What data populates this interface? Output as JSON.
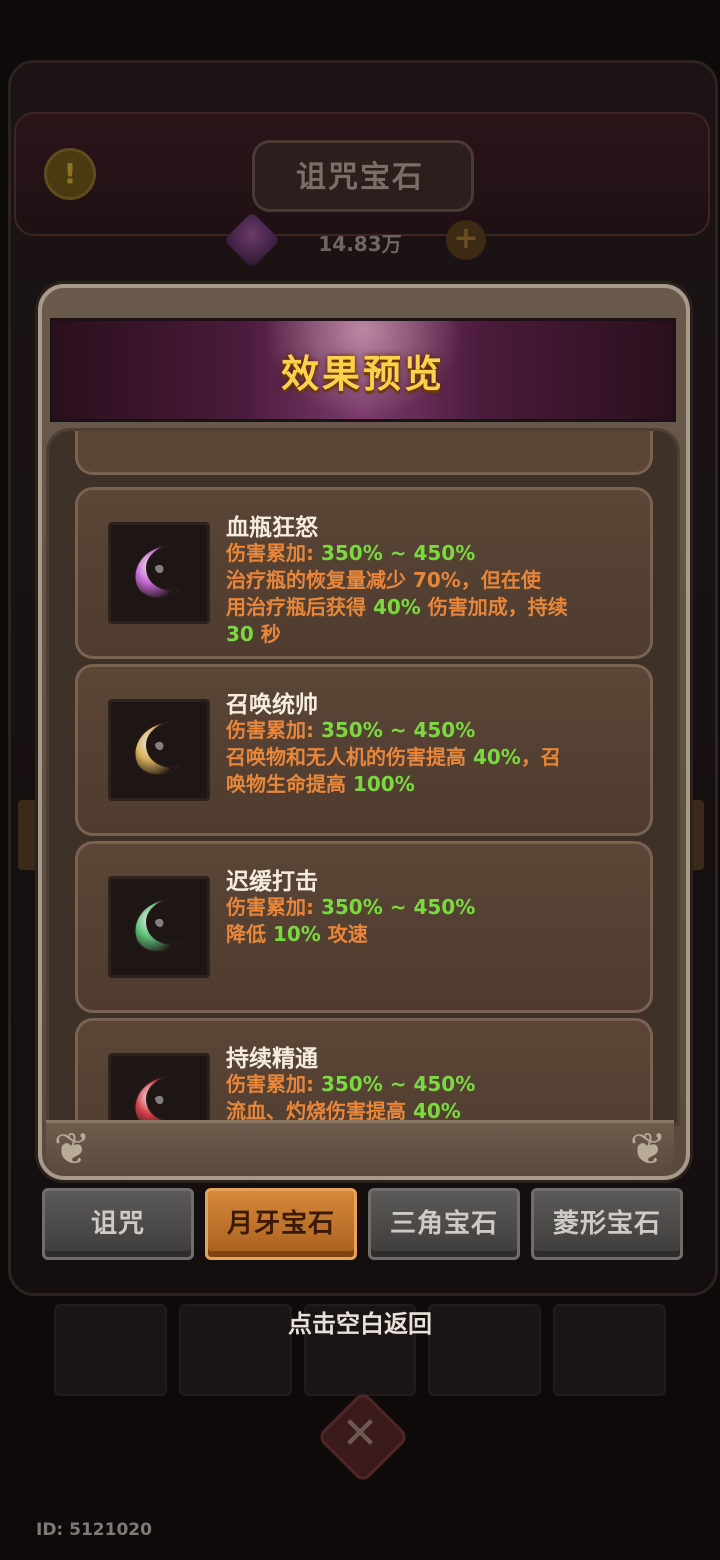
{
  "background": {
    "title": "诅咒宝石",
    "currency_amount": "14.83万",
    "warn_icon": "!",
    "plus_icon": "+"
  },
  "modal": {
    "title": "效果预览",
    "items": [
      {
        "name": "血瓶狂怒",
        "gem_color": "#c66ad6",
        "lines": [
          [
            {
              "t": "伤害累加: ",
              "hl": false
            },
            {
              "t": "350% ~ 450%",
              "hl": true
            }
          ],
          [
            {
              "t": "治疗瓶的恢复量减少 ",
              "hl": false
            },
            {
              "t": "70%",
              "hl": false
            },
            {
              "t": "，但在使",
              "hl": false
            }
          ],
          [
            {
              "t": "用治疗瓶后获得 ",
              "hl": false
            },
            {
              "t": "40%",
              "hl": true
            },
            {
              "t": " 伤害加成，持续",
              "hl": false
            }
          ],
          [
            {
              "t": "30",
              "hl": true
            },
            {
              "t": " 秒",
              "hl": false
            }
          ]
        ]
      },
      {
        "name": "召唤统帅",
        "gem_color": "#d6b25a",
        "lines": [
          [
            {
              "t": "伤害累加: ",
              "hl": false
            },
            {
              "t": "350% ~ 450%",
              "hl": true
            }
          ],
          [
            {
              "t": "召唤物和无人机的伤害提高 ",
              "hl": false
            },
            {
              "t": "40%",
              "hl": true
            },
            {
              "t": "，召",
              "hl": false
            }
          ],
          [
            {
              "t": "唤物生命提高 ",
              "hl": false
            },
            {
              "t": "100%",
              "hl": true
            }
          ]
        ]
      },
      {
        "name": "迟缓打击",
        "gem_color": "#5ec27a",
        "lines": [
          [
            {
              "t": "伤害累加: ",
              "hl": false
            },
            {
              "t": "350% ~ 450%",
              "hl": true
            }
          ],
          [
            {
              "t": "降低 ",
              "hl": false
            },
            {
              "t": "10%",
              "hl": true
            },
            {
              "t": " 攻速",
              "hl": false
            }
          ]
        ]
      },
      {
        "name": "持续精通",
        "gem_color": "#d6404a",
        "lines": [
          [
            {
              "t": "伤害累加: ",
              "hl": false
            },
            {
              "t": "350% ~ 450%",
              "hl": true
            }
          ],
          [
            {
              "t": "流血、灼烧伤害提高 ",
              "hl": false
            },
            {
              "t": "40%",
              "hl": true
            }
          ]
        ]
      }
    ]
  },
  "tabs": [
    {
      "label": "诅咒",
      "active": false
    },
    {
      "label": "月牙宝石",
      "active": true
    },
    {
      "label": "三角宝石",
      "active": false
    },
    {
      "label": "菱形宝石",
      "active": false
    }
  ],
  "dismiss_hint": "点击空白返回",
  "player_id": "ID: 5121020",
  "colors": {
    "highlight": "#7bd940",
    "effect_text": "#e8863a",
    "title_gold": "#ffd14a",
    "active_tab": "#d6883a"
  }
}
